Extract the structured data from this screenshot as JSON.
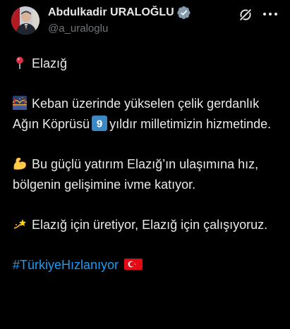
{
  "author": {
    "display_name": "Abdulkadir URALOĞLU",
    "handle": "@a_uraloglu",
    "verified": true
  },
  "icons": {
    "verified": "verified-badge-icon",
    "grok": "grok-icon",
    "more": "more-options-icon"
  },
  "tweet": {
    "lines": [
      {
        "emoji": "round-pushpin-icon",
        "text": "Elazığ"
      },
      {
        "emoji": "bridge-at-night-icon",
        "text_before": "Keban üzerinde yükselen çelik gerdanlık Ağın Köprüsü",
        "inline_emoji": "keycap-9",
        "inline_emoji_label": "9",
        "text_after": "yıldır milletimizin hizmetinde."
      },
      {
        "emoji": "flexed-biceps-icon",
        "text": "Bu güçlü yatırım Elazığ’ın ulaşımına hız, bölgenin gelişimine ivme katıyor."
      },
      {
        "emoji": "dizzy-icon",
        "text": "Elazığ için üretiyor, Elazığ için çalışıyoruz."
      }
    ],
    "hashtag": "#TürkiyeHızlanıyor",
    "hashtag_flag": "turkey-flag-icon"
  },
  "colors": {
    "background": "#000000",
    "text": "#e7e9ea",
    "secondary": "#71767b",
    "link": "#1d9bf0",
    "verified": "#829aab"
  }
}
